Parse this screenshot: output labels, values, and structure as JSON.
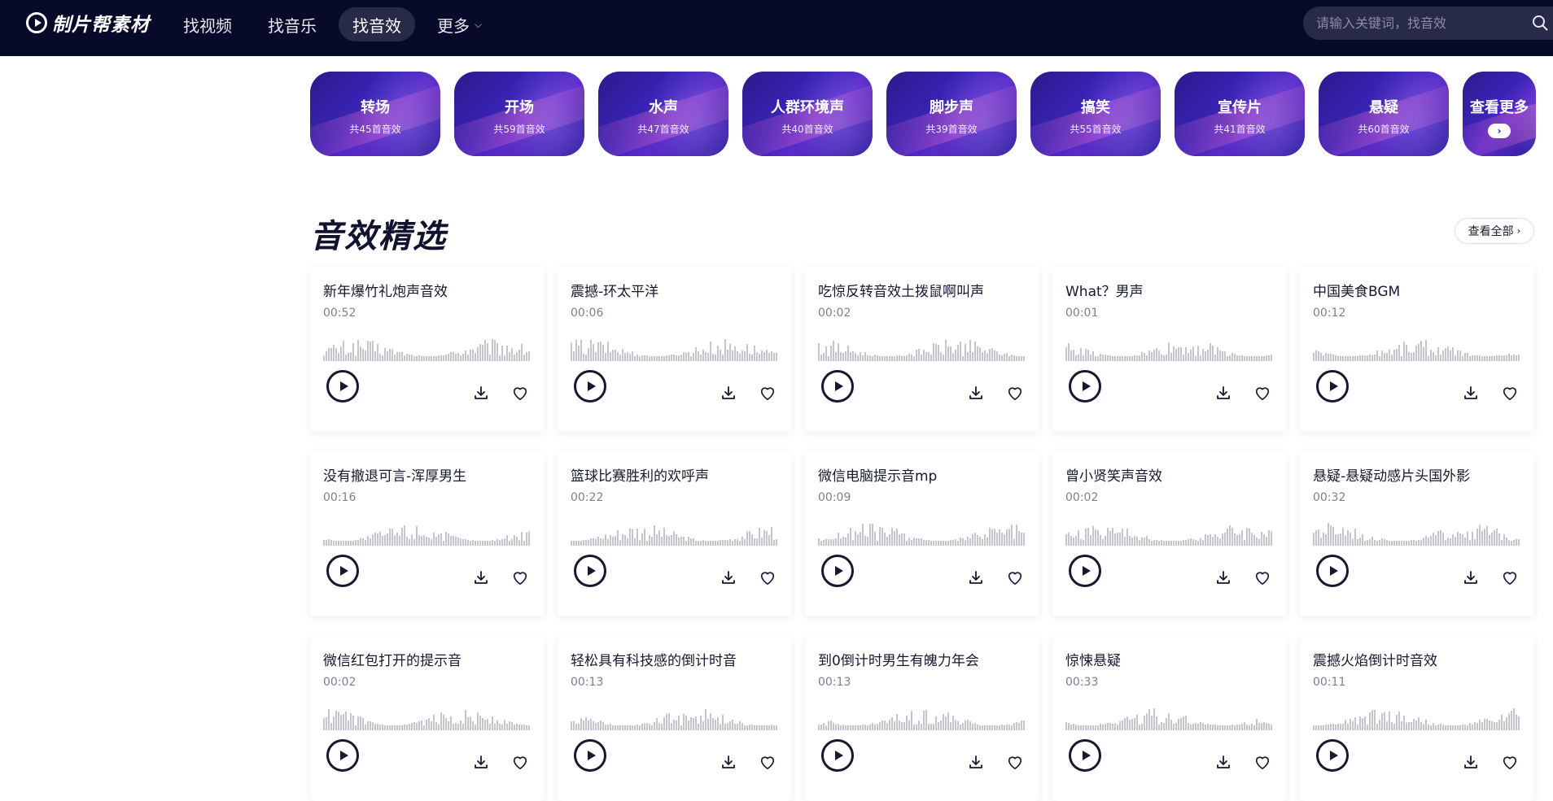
{
  "header": {
    "logo_text": "制片帮素材",
    "nav": [
      {
        "label": "找视频",
        "active": false
      },
      {
        "label": "找音乐",
        "active": false
      },
      {
        "label": "找音效",
        "active": true
      },
      {
        "label": "更多",
        "active": false
      }
    ],
    "search_placeholder": "请输入关键词，找音效",
    "icons": [
      "logo-play-icon",
      "chevron-down-icon",
      "search-icon"
    ]
  },
  "categories": [
    {
      "name": "转场",
      "count": "共45首音效"
    },
    {
      "name": "开场",
      "count": "共59首音效"
    },
    {
      "name": "水声",
      "count": "共47首音效"
    },
    {
      "name": "人群环境声",
      "count": "共40首音效"
    },
    {
      "name": "脚步声",
      "count": "共39首音效"
    },
    {
      "name": "搞笑",
      "count": "共55首音效"
    },
    {
      "name": "宣传片",
      "count": "共41首音效"
    },
    {
      "name": "悬疑",
      "count": "共60首音效"
    }
  ],
  "more_category": {
    "label": "查看更多",
    "button": "›"
  },
  "section": {
    "title": "音效精选",
    "view_all": "查看全部",
    "view_all_arrow": "›"
  },
  "cards": [
    {
      "title": "新年爆竹礼炮声音效",
      "duration": "00:52"
    },
    {
      "title": "震撼-环太平洋",
      "duration": "00:06"
    },
    {
      "title": "吃惊反转音效土拨鼠啊叫声",
      "duration": "00:02"
    },
    {
      "title": "What？男声",
      "duration": "00:01"
    },
    {
      "title": "中国美食BGM",
      "duration": "00:12"
    },
    {
      "title": "没有撤退可言-浑厚男生",
      "duration": "00:16"
    },
    {
      "title": "篮球比赛胜利的欢呼声",
      "duration": "00:22"
    },
    {
      "title": "微信电脑提示音mp",
      "duration": "00:09"
    },
    {
      "title": "曾小贤笑声音效",
      "duration": "00:02"
    },
    {
      "title": "悬疑-悬疑动感片头国外影",
      "duration": "00:32"
    },
    {
      "title": "微信红包打开的提示音",
      "duration": "00:02"
    },
    {
      "title": "轻松具有科技感的倒计时音",
      "duration": "00:13"
    },
    {
      "title": "到0倒计时男生有魄力年会",
      "duration": "00:13"
    },
    {
      "title": "惊悚悬疑",
      "duration": "00:33"
    },
    {
      "title": "震撼火焰倒计时音效",
      "duration": "00:11"
    }
  ],
  "colors": {
    "nav_bg": "#080a29",
    "accent": "#3a23b5",
    "waveform": "#c4c5ce"
  }
}
